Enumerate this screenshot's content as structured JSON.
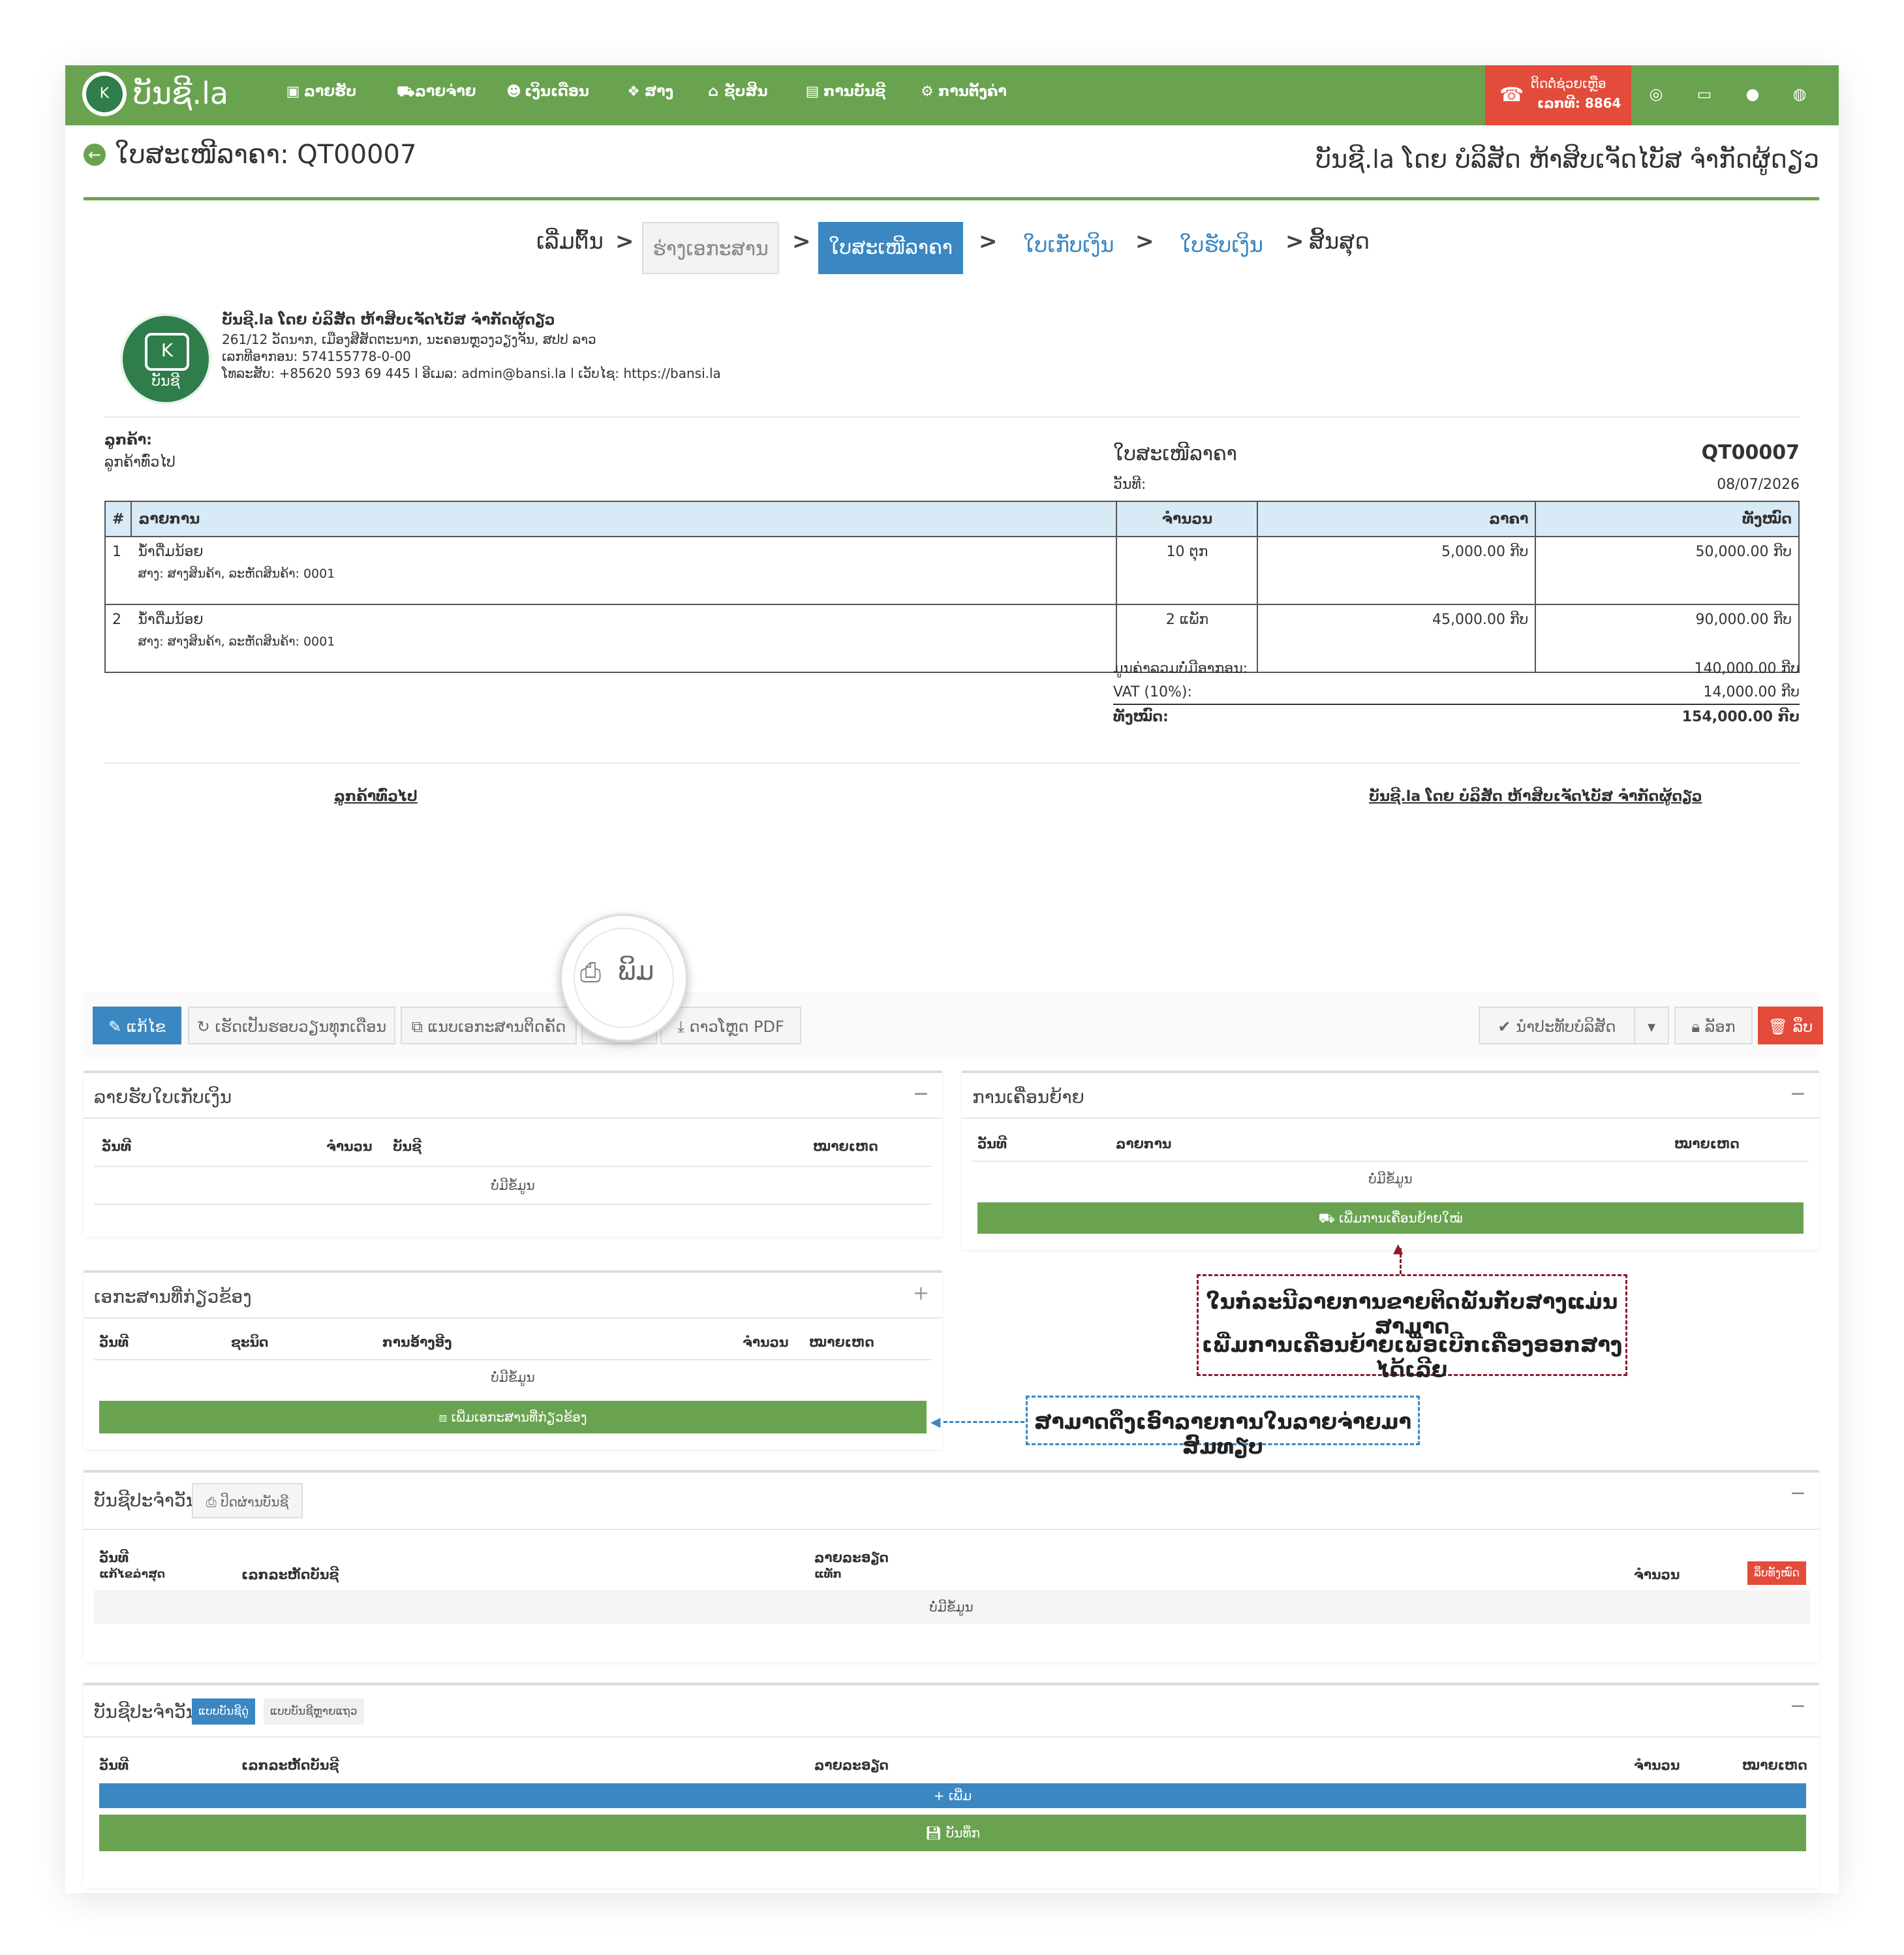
{
  "navbar": {
    "logo_text": "ບັນຊີ.la",
    "items": [
      {
        "icon": "money-icon",
        "label": "ລາຍຮັບ"
      },
      {
        "icon": "cart-icon",
        "label": "ລາຍຈ່າຍ"
      },
      {
        "icon": "users-icon",
        "label": "ເງິນເດືອນ"
      },
      {
        "icon": "dropbox-icon",
        "label": "ສາງ"
      },
      {
        "icon": "bank-icon",
        "label": "ຊັບສິນ"
      },
      {
        "icon": "book-icon",
        "label": "ການບັນຊີ"
      },
      {
        "icon": "cogs-icon",
        "label": "ການຕັ້ງຄ່າ"
      }
    ],
    "help": {
      "line1": "ຕິດຕໍ່ຊ່ວຍເຫຼືອ",
      "line2": "ເລກທີ: 8864"
    }
  },
  "header": {
    "title": "ໃບສະເໜີລາຄາ: QT00007",
    "company_title": "ບັນຊີ.la ໂດຍ ບໍລິສັດ ຫ້າສິບເຈັດໄບັສ ຈຳກັດຜູ້ດຽວ"
  },
  "steps": [
    "ເລີ່ມຕົ້ນ",
    "ຮ່າງເອກະສານ",
    "ໃບສະເໜີລາຄາ",
    "ໃບເກັບເງິນ",
    "ໃບຮັບເງິນ",
    "ສິ້ນສຸດ"
  ],
  "company": {
    "name": "ບັນຊີ.la ໂດຍ ບໍລິສັດ ຫ້າສິບເຈັດໄບັສ ຈຳກັດຜູ້ດຽວ",
    "address": "261/12 ວັດນາກ, ເມືອງສີສັດຕະນາກ, ນະຄອນຫຼວງວຽງຈັນ, ສປປ ລາວ",
    "tax": "ເລກທີອາກອນ: 574155778-0-00",
    "contact": "ໂທລະສັບ: +85620 593 69 445 l ອີເມລ: admin@bansi.la l ເວັບໄຊ: https://bansi.la",
    "logo_text": "ບັນຊີ"
  },
  "document": {
    "customer_label": "ລູກຄ້າ:",
    "customer_value": "ລູກຄ້າທົ່ວໄປ",
    "doc_type": "ໃບສະເໜີລາຄາ",
    "doc_number": "QT00007",
    "date_label": "ວັນທີ:",
    "date_value": "08/07/2026",
    "columns": [
      "#",
      "ລາຍການ",
      "ຈຳນວນ",
      "ລາຄາ",
      "ທັງໝົດ"
    ],
    "rows": [
      {
        "no": "1",
        "name": "ນ້ຳດື່ມນ້ອຍ",
        "sub": "ສາງ: ສາງສິນຄ້າ, ລະຫັດສິນຄ້າ: 0001",
        "qty": "10 ຕຸກ",
        "price": "5,000.00 ກີບ",
        "total": "50,000.00 ກີບ"
      },
      {
        "no": "2",
        "name": "ນ້ຳດື່ມນ້ອຍ",
        "sub": "ສາງ: ສາງສິນຄ້າ, ລະຫັດສິນຄ້າ: 0001",
        "qty": "2 ແພັກ",
        "price": "45,000.00 ກີບ",
        "total": "90,000.00 ກີບ"
      }
    ],
    "subtotal_label": "ມູນຄ່າລວມບໍ່ມີອາກອນ:",
    "subtotal_value": "140,000.00 ກີບ",
    "vat_label": "VAT (10%):",
    "vat_value": "14,000.00 ກີບ",
    "total_label": "ທັງໝົດ:",
    "total_value": "154,000.00 ກີບ",
    "sign_customer": "ລູກຄ້າທົ່ວໄປ",
    "sign_company": "ບັນຊີ.la ໂດຍ ບໍລິສັດ ຫ້າສິບເຈັດໄບັສ ຈຳກັດຜູ້ດຽວ"
  },
  "print_bubble": "ພິມ",
  "actions": {
    "edit": "ແກ້ໄຂ",
    "recurring": "ເຮັດເປັນຮອບວຽນທຸກເດືອນ",
    "attach": "ແນບເອກະສານຕິດຄັດ",
    "pdf": "ດາວໂຫຼດ PDF",
    "apply_company": "ນຳປະທັບບໍລິສັດ",
    "lock": "ລັອກ",
    "delete": "ລຶບ"
  },
  "panels": {
    "income": {
      "title": "ລາຍຮັບໃບເກັບເງິນ",
      "cols": [
        "ວັນທີ",
        "ຈຳນວນ",
        "ບັນຊີ",
        "ໝາຍເຫດ"
      ],
      "empty": "ບໍ່ມີຂໍ້ມູນ"
    },
    "movement": {
      "title": "ການເຄື່ອນຍ້າຍ",
      "cols": [
        "ວັນທີ",
        "ລາຍການ",
        "ໝາຍເຫດ"
      ],
      "empty": "ບໍ່ມີຂໍ້ມູນ",
      "button": "ເພີ່ມການເຄື່ອນຍ້າຍໃໝ່"
    },
    "related": {
      "title": "ເອກະສານທີ່ກ່ຽວຂ້ອງ",
      "cols": [
        "ວັນທີ",
        "ຊະນິດ",
        "ການອ້າງອີງ",
        "ຈຳນວນ",
        "ໝາຍເຫດ"
      ],
      "empty": "ບໍ່ມີຂໍ້ມູນ",
      "button": "ເພີ່ມເອກະສານທີ່ກ່ຽວຂ້ອງ"
    },
    "journal1": {
      "title": "ບັນຊີປະຈຳວັນ",
      "print_btn": "ປິດຜ່ານບັນຊີ",
      "col_date": "ວັນທີ",
      "col_date_sub": "ແກ້ໄຂລ່າສຸດ",
      "col_code": "ເລກລະຫັດບັນຊີ",
      "col_detail": "ລາຍລະອຽດ",
      "col_detail_sub": "ແທັກ",
      "col_amount": "ຈຳນວນ",
      "delete_all": "ລຶບທັງໝົດ",
      "empty": "ບໍ່ມີຂໍ້ມູນ"
    },
    "journal2": {
      "title": "ບັນຊີປະຈຳວັນ",
      "tab1": "ແບບບັນຊີດູ່",
      "tab2": "ແບບບັນຊີຫຼາຍແຖວ",
      "cols": [
        "ວັນທີ",
        "ເລກລະຫັດບັນຊີ",
        "ລາຍລະອຽດ",
        "ຈຳນວນ",
        "ໝາຍເຫດ"
      ],
      "add": "ເພີ່ມ",
      "save": "ບັນທຶກ"
    }
  },
  "callouts": {
    "red_line1": "ໃນກໍລະນີລາຍການຂາຍຕິດພັນກັບສາງແມ່ນສາມາດ",
    "red_line2": "ເພີ່ມການເຄື່ອນຍ້າຍເພື່ອເບີກເຄື່ອງອອກສາງໄດ້ເລີຍ",
    "blue": "ສາມາດດຶງເອົາລາຍການໃນລາຍຈ່າຍມາສົມທຽບ"
  },
  "colors": {
    "green": "#6aa350",
    "blue": "#3a87c2",
    "red": "#e34b3a",
    "callout_red": "#8b1c2b",
    "callout_blue": "#3a87c2"
  }
}
